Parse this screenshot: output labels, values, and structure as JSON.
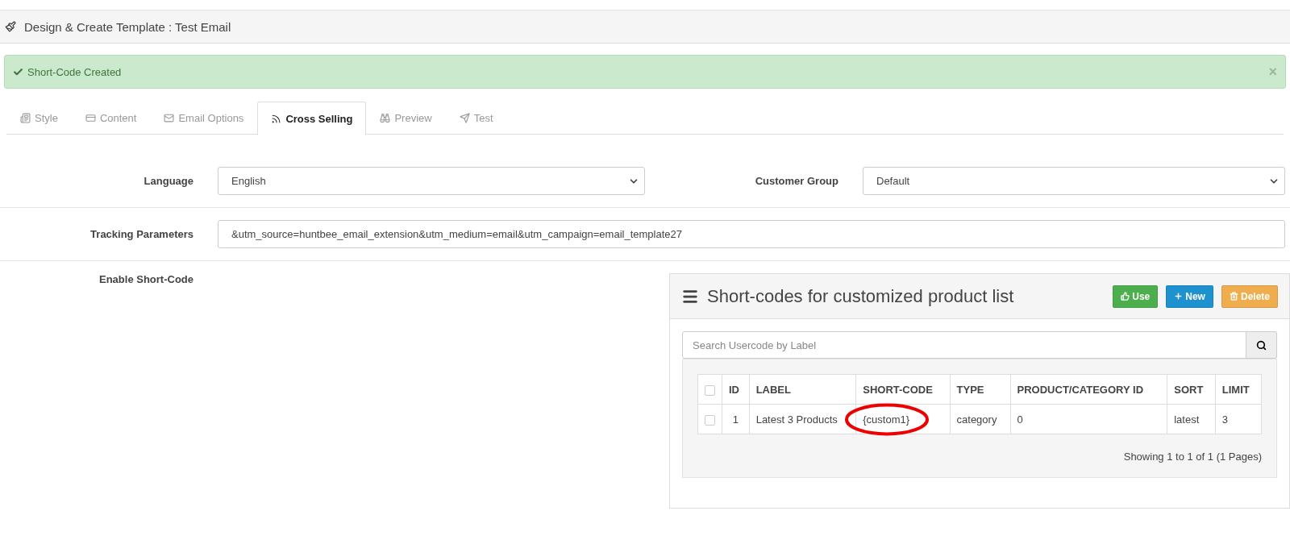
{
  "header": {
    "title": "Design & Create Template : Test Email"
  },
  "alert": {
    "message": "Short-Code Created",
    "close": "×"
  },
  "tabs": [
    {
      "label": "Style",
      "selected": false
    },
    {
      "label": "Content",
      "selected": false
    },
    {
      "label": "Email Options",
      "selected": false
    },
    {
      "label": "Cross Selling",
      "selected": true
    },
    {
      "label": "Preview",
      "selected": false
    },
    {
      "label": "Test",
      "selected": false
    }
  ],
  "language": {
    "label": "Language",
    "value": "English"
  },
  "customer_group": {
    "label": "Customer Group",
    "value": "Default"
  },
  "tracking": {
    "label": "Tracking Parameters",
    "value": "&utm_source=huntbee_email_extension&utm_medium=email&utm_campaign=email_template27"
  },
  "short_code": {
    "label": "Enable Short-Code"
  },
  "panel": {
    "title": "Short-codes for customized product list",
    "buttons": [
      {
        "label": "Use",
        "kind": "use"
      },
      {
        "label": "New",
        "kind": "new"
      },
      {
        "label": "Delete",
        "kind": "delete"
      }
    ],
    "search": {
      "placeholder": "Search Usercode by Label"
    },
    "table": {
      "columns": [
        "ID",
        "LABEL",
        "SHORT-CODE",
        "TYPE",
        "PRODUCT/CATEGORY ID",
        "SORT",
        "LIMIT"
      ],
      "select_all_checked": false,
      "rows": [
        {
          "checked": false,
          "cells": [
            {
              "text": "1",
              "circled": false
            },
            {
              "text": "Latest 3 Products",
              "circled": false
            },
            {
              "text": "{custom1}",
              "circled": true
            },
            {
              "text": "category",
              "circled": false
            },
            {
              "text": "0",
              "circled": false
            },
            {
              "text": "latest",
              "circled": false
            },
            {
              "text": "3",
              "circled": false
            }
          ]
        }
      ]
    },
    "pagination": "Showing 1 to 1 of 1 (1 Pages)"
  }
}
